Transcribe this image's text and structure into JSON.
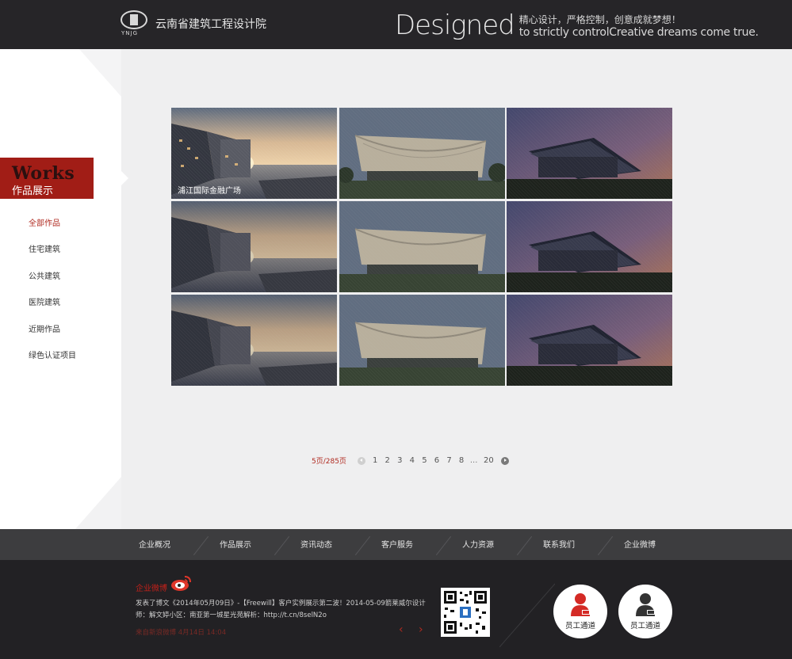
{
  "header": {
    "logo_text": "云南省建筑工程设计院",
    "logo_sub": "YNJG",
    "slogan_big": "Designed",
    "slogan_cn": "精心设计，严格控制，创意成就梦想！",
    "slogan_en": "to strictly controlCreative dreams come true."
  },
  "sidebar": {
    "section_en": "Works",
    "section_cn": "作品展示",
    "menu": [
      {
        "label": "全部作品",
        "active": true
      },
      {
        "label": "住宅建筑"
      },
      {
        "label": "公共建筑"
      },
      {
        "label": "医院建筑"
      },
      {
        "label": "近期作品"
      },
      {
        "label": "绿色认证项目"
      }
    ]
  },
  "gallery": {
    "caption": "浦江国际金融广场"
  },
  "pagination": {
    "info": "5页/285页",
    "pages": [
      "1",
      "2",
      "3",
      "4",
      "5",
      "6",
      "7",
      "8"
    ],
    "dots": "...",
    "last": "20"
  },
  "footer_nav": [
    "企业概况",
    "作品展示",
    "资讯动态",
    "客户服务",
    "人力资源",
    "联系我们",
    "企业微博"
  ],
  "footer": {
    "weibo_title": "企业微博",
    "weibo_post": "发表了博文《2014年05月09日》-【Freewill】客户实例展示第二波！2014-05-09箭莱威尔设计师：解文婷小区：南亚第一城星光苑解析：http://t.cn/8selN2o",
    "weibo_meta": "来自新浪微博 4月14日 14:04",
    "prev": "‹",
    "next": "›",
    "staff1_label": "员工通道",
    "staff2_label": "员工通道"
  },
  "colors": {
    "accent": "#b02a20",
    "header_bg": "#262528",
    "footer_bg": "#222124"
  }
}
